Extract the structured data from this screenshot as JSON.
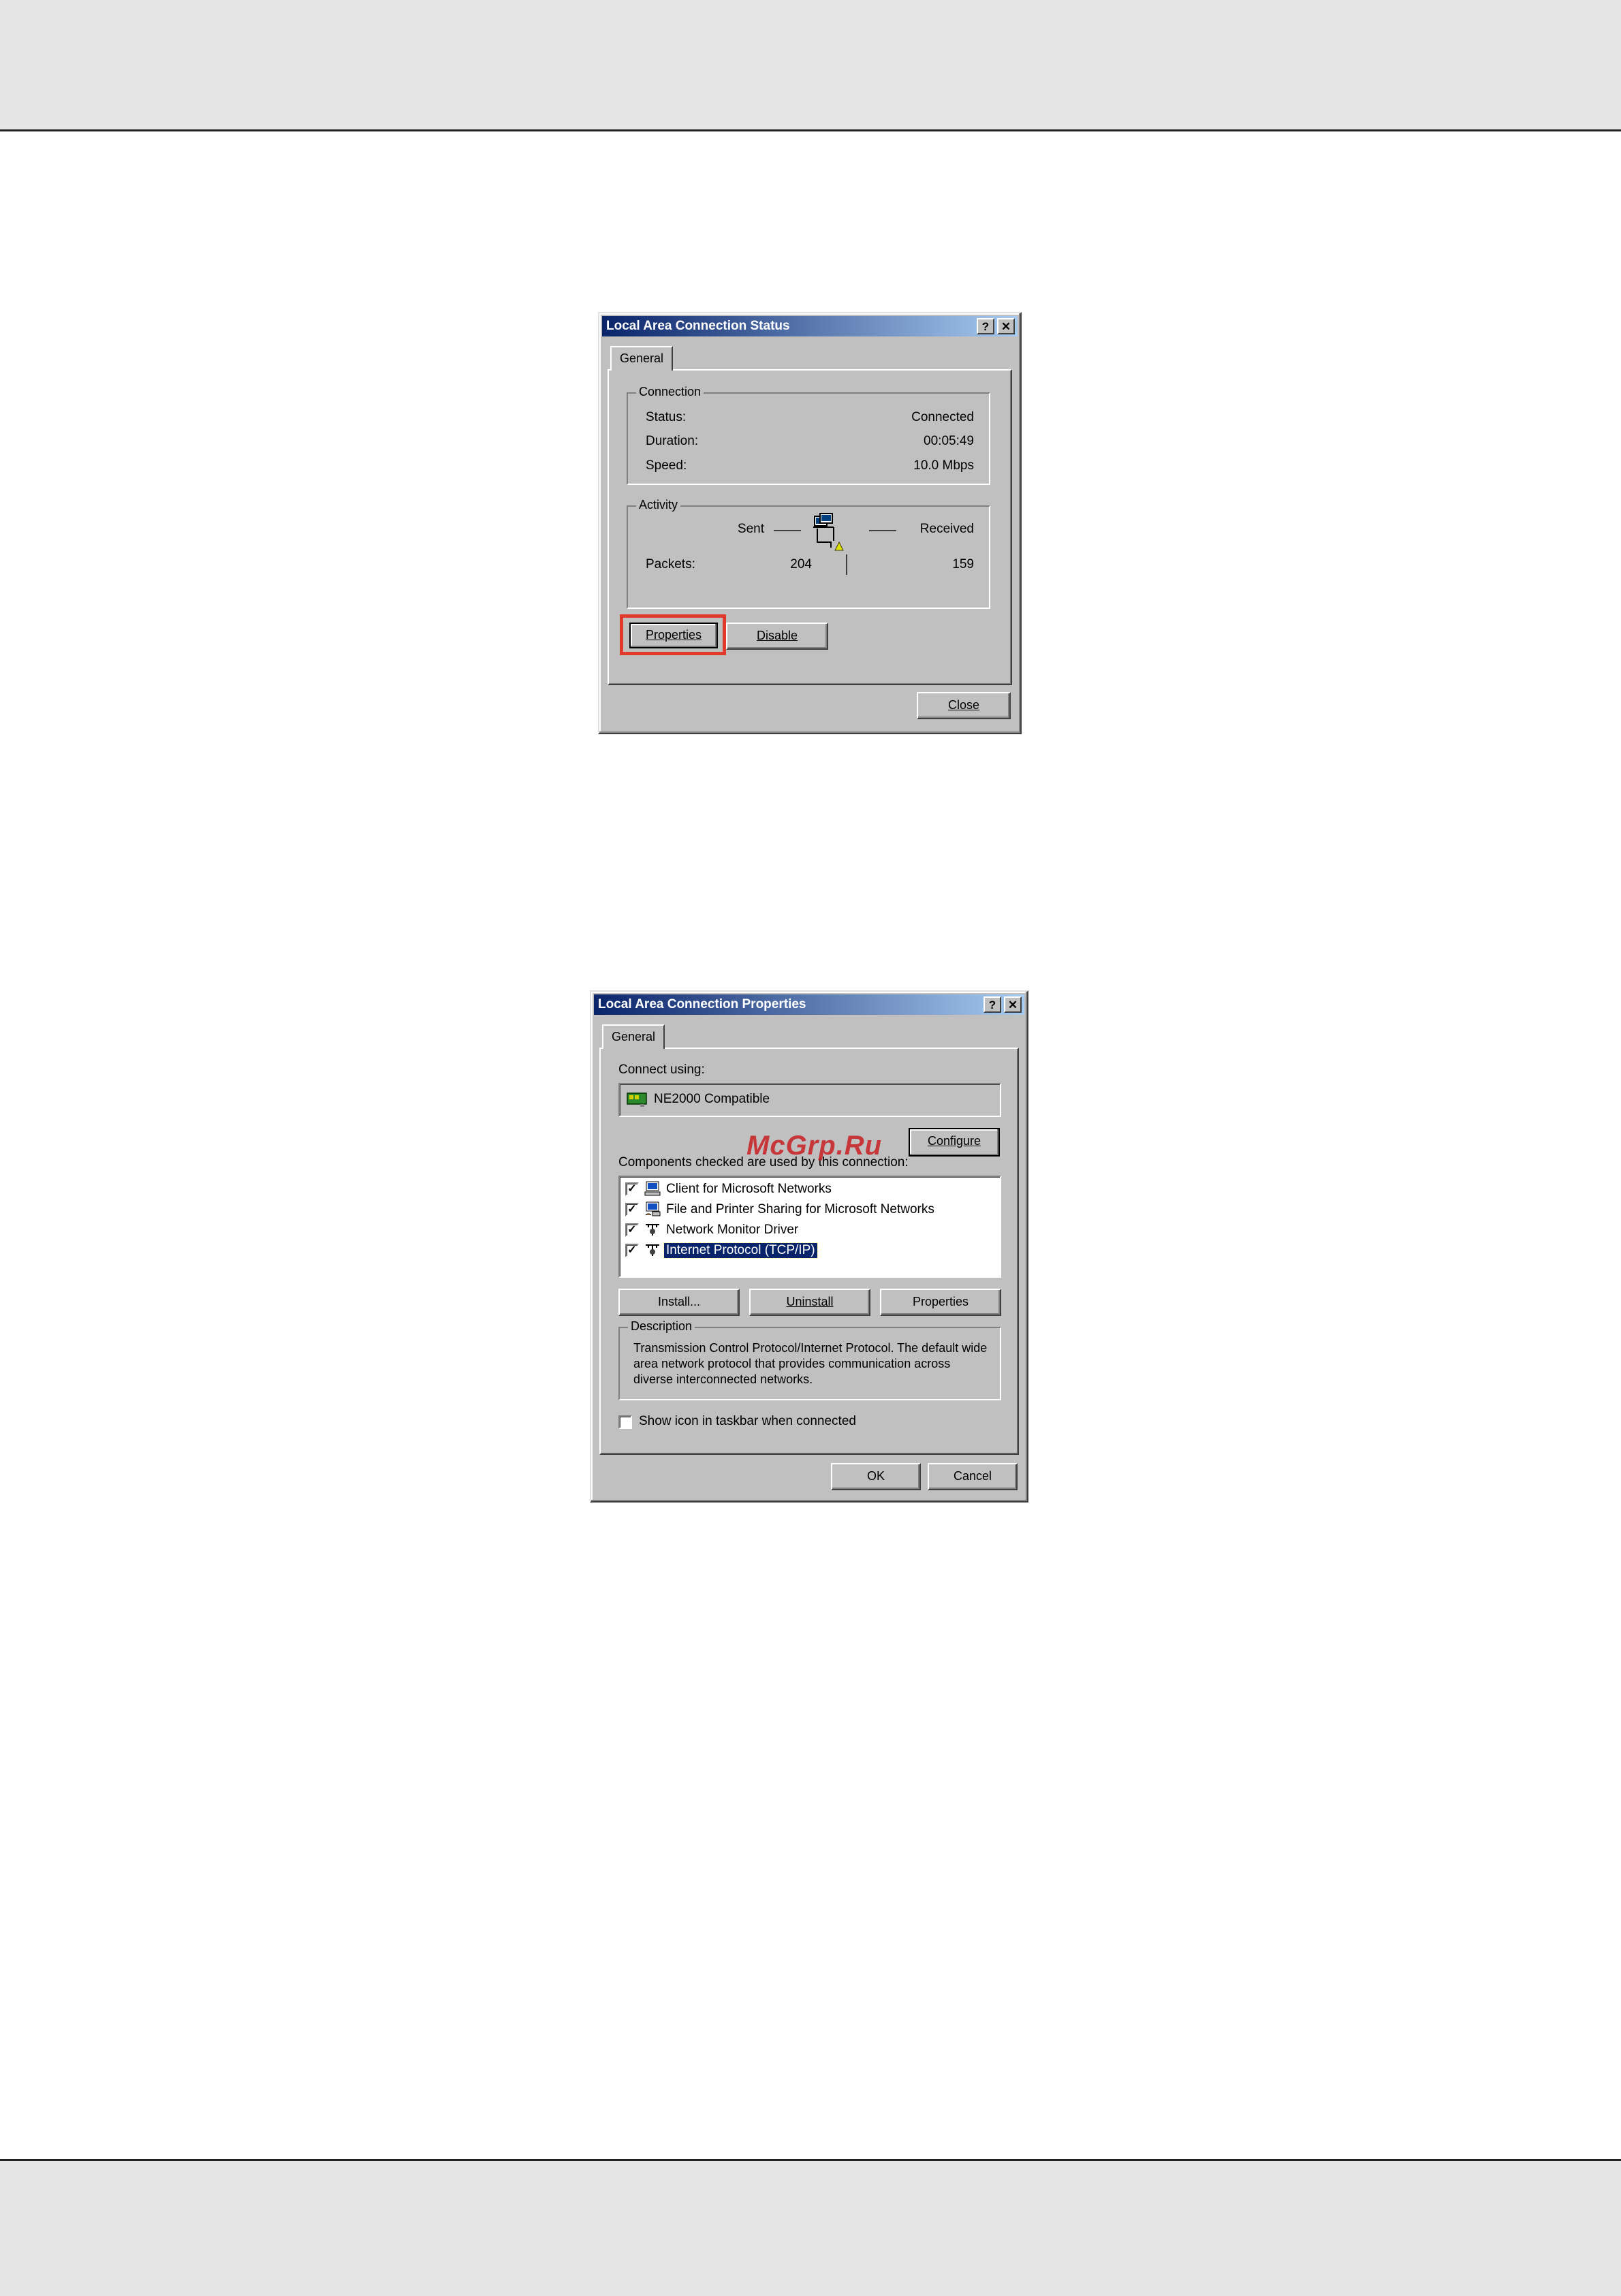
{
  "status_dialog": {
    "title": "Local Area Connection Status",
    "help_btn": "?",
    "close_btn": "✕",
    "tab": "General",
    "connection": {
      "group": "Connection",
      "status_label": "Status:",
      "status_value": "Connected",
      "duration_label": "Duration:",
      "duration_value": "00:05:49",
      "speed_label": "Speed:",
      "speed_value": "10.0 Mbps"
    },
    "activity": {
      "group": "Activity",
      "sent_label": "Sent",
      "received_label": "Received",
      "packets_label": "Packets:",
      "packets_sent": "204",
      "packets_received": "159"
    },
    "properties_button": "Properties",
    "disable_button": "Disable",
    "close_button": "Close",
    "highlight_color": "#e03a2f"
  },
  "properties_dialog": {
    "title": "Local Area Connection Properties",
    "help_btn": "?",
    "close_btn": "✕",
    "tab": "General",
    "connect_using_label": "Connect using:",
    "adapter_name": "NE2000 Compatible",
    "configure_button": "Configure",
    "components_label": "Components checked are used by this connection:",
    "components": [
      {
        "label": "Client for Microsoft Networks",
        "checked": true,
        "icon": "network-client-icon"
      },
      {
        "label": "File and Printer Sharing for Microsoft Networks",
        "checked": true,
        "icon": "file-printer-sharing-icon"
      },
      {
        "label": "Network Monitor Driver",
        "checked": true,
        "icon": "protocol-icon"
      },
      {
        "label": "Internet Protocol (TCP/IP)",
        "checked": true,
        "icon": "protocol-icon",
        "selected": true
      }
    ],
    "install_button": "Install...",
    "uninstall_button": "Uninstall",
    "properties_button": "Properties",
    "description_group": "Description",
    "description_text": "Transmission Control Protocol/Internet Protocol. The default wide area network protocol that provides communication across diverse interconnected networks.",
    "show_icon_label": "Show icon in taskbar when connected",
    "show_icon_checked": false,
    "ok_button": "OK",
    "cancel_button": "Cancel"
  },
  "watermark": "McGrp.Ru"
}
